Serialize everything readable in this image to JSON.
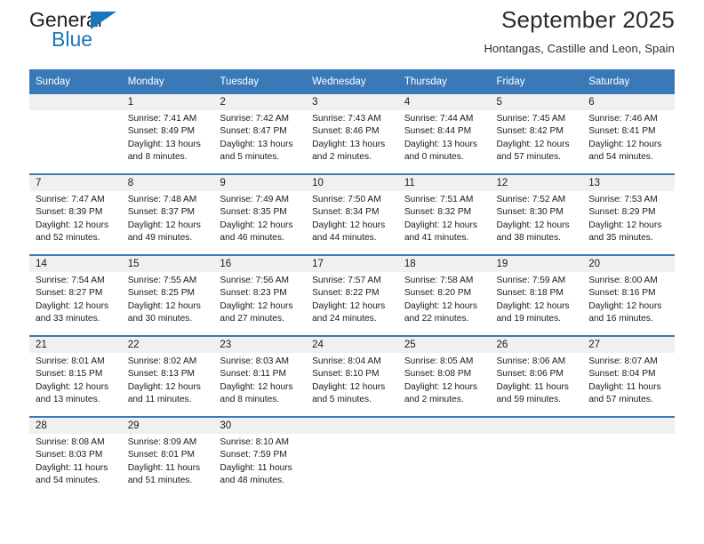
{
  "brand": {
    "name_part1": "General",
    "name_part2": "Blue",
    "triangle_color": "#1b75bb"
  },
  "header": {
    "title": "September 2025",
    "subtitle": "Hontangas, Castille and Leon, Spain",
    "accent_color": "#3a79b8",
    "band_color": "#f0f0f0"
  },
  "calendar": {
    "weekday_headers": [
      "Sunday",
      "Monday",
      "Tuesday",
      "Wednesday",
      "Thursday",
      "Friday",
      "Saturday"
    ],
    "labels": {
      "sunrise": "Sunrise:",
      "sunset": "Sunset:",
      "daylight": "Daylight:"
    },
    "weeks": [
      [
        {
          "day": ""
        },
        {
          "day": "1",
          "sunrise": "Sunrise: 7:41 AM",
          "sunset": "Sunset: 8:49 PM",
          "daylight_l1": "Daylight: 13 hours",
          "daylight_l2": "and 8 minutes."
        },
        {
          "day": "2",
          "sunrise": "Sunrise: 7:42 AM",
          "sunset": "Sunset: 8:47 PM",
          "daylight_l1": "Daylight: 13 hours",
          "daylight_l2": "and 5 minutes."
        },
        {
          "day": "3",
          "sunrise": "Sunrise: 7:43 AM",
          "sunset": "Sunset: 8:46 PM",
          "daylight_l1": "Daylight: 13 hours",
          "daylight_l2": "and 2 minutes."
        },
        {
          "day": "4",
          "sunrise": "Sunrise: 7:44 AM",
          "sunset": "Sunset: 8:44 PM",
          "daylight_l1": "Daylight: 13 hours",
          "daylight_l2": "and 0 minutes."
        },
        {
          "day": "5",
          "sunrise": "Sunrise: 7:45 AM",
          "sunset": "Sunset: 8:42 PM",
          "daylight_l1": "Daylight: 12 hours",
          "daylight_l2": "and 57 minutes."
        },
        {
          "day": "6",
          "sunrise": "Sunrise: 7:46 AM",
          "sunset": "Sunset: 8:41 PM",
          "daylight_l1": "Daylight: 12 hours",
          "daylight_l2": "and 54 minutes."
        }
      ],
      [
        {
          "day": "7",
          "sunrise": "Sunrise: 7:47 AM",
          "sunset": "Sunset: 8:39 PM",
          "daylight_l1": "Daylight: 12 hours",
          "daylight_l2": "and 52 minutes."
        },
        {
          "day": "8",
          "sunrise": "Sunrise: 7:48 AM",
          "sunset": "Sunset: 8:37 PM",
          "daylight_l1": "Daylight: 12 hours",
          "daylight_l2": "and 49 minutes."
        },
        {
          "day": "9",
          "sunrise": "Sunrise: 7:49 AM",
          "sunset": "Sunset: 8:35 PM",
          "daylight_l1": "Daylight: 12 hours",
          "daylight_l2": "and 46 minutes."
        },
        {
          "day": "10",
          "sunrise": "Sunrise: 7:50 AM",
          "sunset": "Sunset: 8:34 PM",
          "daylight_l1": "Daylight: 12 hours",
          "daylight_l2": "and 44 minutes."
        },
        {
          "day": "11",
          "sunrise": "Sunrise: 7:51 AM",
          "sunset": "Sunset: 8:32 PM",
          "daylight_l1": "Daylight: 12 hours",
          "daylight_l2": "and 41 minutes."
        },
        {
          "day": "12",
          "sunrise": "Sunrise: 7:52 AM",
          "sunset": "Sunset: 8:30 PM",
          "daylight_l1": "Daylight: 12 hours",
          "daylight_l2": "and 38 minutes."
        },
        {
          "day": "13",
          "sunrise": "Sunrise: 7:53 AM",
          "sunset": "Sunset: 8:29 PM",
          "daylight_l1": "Daylight: 12 hours",
          "daylight_l2": "and 35 minutes."
        }
      ],
      [
        {
          "day": "14",
          "sunrise": "Sunrise: 7:54 AM",
          "sunset": "Sunset: 8:27 PM",
          "daylight_l1": "Daylight: 12 hours",
          "daylight_l2": "and 33 minutes."
        },
        {
          "day": "15",
          "sunrise": "Sunrise: 7:55 AM",
          "sunset": "Sunset: 8:25 PM",
          "daylight_l1": "Daylight: 12 hours",
          "daylight_l2": "and 30 minutes."
        },
        {
          "day": "16",
          "sunrise": "Sunrise: 7:56 AM",
          "sunset": "Sunset: 8:23 PM",
          "daylight_l1": "Daylight: 12 hours",
          "daylight_l2": "and 27 minutes."
        },
        {
          "day": "17",
          "sunrise": "Sunrise: 7:57 AM",
          "sunset": "Sunset: 8:22 PM",
          "daylight_l1": "Daylight: 12 hours",
          "daylight_l2": "and 24 minutes."
        },
        {
          "day": "18",
          "sunrise": "Sunrise: 7:58 AM",
          "sunset": "Sunset: 8:20 PM",
          "daylight_l1": "Daylight: 12 hours",
          "daylight_l2": "and 22 minutes."
        },
        {
          "day": "19",
          "sunrise": "Sunrise: 7:59 AM",
          "sunset": "Sunset: 8:18 PM",
          "daylight_l1": "Daylight: 12 hours",
          "daylight_l2": "and 19 minutes."
        },
        {
          "day": "20",
          "sunrise": "Sunrise: 8:00 AM",
          "sunset": "Sunset: 8:16 PM",
          "daylight_l1": "Daylight: 12 hours",
          "daylight_l2": "and 16 minutes."
        }
      ],
      [
        {
          "day": "21",
          "sunrise": "Sunrise: 8:01 AM",
          "sunset": "Sunset: 8:15 PM",
          "daylight_l1": "Daylight: 12 hours",
          "daylight_l2": "and 13 minutes."
        },
        {
          "day": "22",
          "sunrise": "Sunrise: 8:02 AM",
          "sunset": "Sunset: 8:13 PM",
          "daylight_l1": "Daylight: 12 hours",
          "daylight_l2": "and 11 minutes."
        },
        {
          "day": "23",
          "sunrise": "Sunrise: 8:03 AM",
          "sunset": "Sunset: 8:11 PM",
          "daylight_l1": "Daylight: 12 hours",
          "daylight_l2": "and 8 minutes."
        },
        {
          "day": "24",
          "sunrise": "Sunrise: 8:04 AM",
          "sunset": "Sunset: 8:10 PM",
          "daylight_l1": "Daylight: 12 hours",
          "daylight_l2": "and 5 minutes."
        },
        {
          "day": "25",
          "sunrise": "Sunrise: 8:05 AM",
          "sunset": "Sunset: 8:08 PM",
          "daylight_l1": "Daylight: 12 hours",
          "daylight_l2": "and 2 minutes."
        },
        {
          "day": "26",
          "sunrise": "Sunrise: 8:06 AM",
          "sunset": "Sunset: 8:06 PM",
          "daylight_l1": "Daylight: 11 hours",
          "daylight_l2": "and 59 minutes."
        },
        {
          "day": "27",
          "sunrise": "Sunrise: 8:07 AM",
          "sunset": "Sunset: 8:04 PM",
          "daylight_l1": "Daylight: 11 hours",
          "daylight_l2": "and 57 minutes."
        }
      ],
      [
        {
          "day": "28",
          "sunrise": "Sunrise: 8:08 AM",
          "sunset": "Sunset: 8:03 PM",
          "daylight_l1": "Daylight: 11 hours",
          "daylight_l2": "and 54 minutes."
        },
        {
          "day": "29",
          "sunrise": "Sunrise: 8:09 AM",
          "sunset": "Sunset: 8:01 PM",
          "daylight_l1": "Daylight: 11 hours",
          "daylight_l2": "and 51 minutes."
        },
        {
          "day": "30",
          "sunrise": "Sunrise: 8:10 AM",
          "sunset": "Sunset: 7:59 PM",
          "daylight_l1": "Daylight: 11 hours",
          "daylight_l2": "and 48 minutes."
        },
        {
          "day": ""
        },
        {
          "day": ""
        },
        {
          "day": ""
        },
        {
          "day": ""
        }
      ]
    ]
  }
}
